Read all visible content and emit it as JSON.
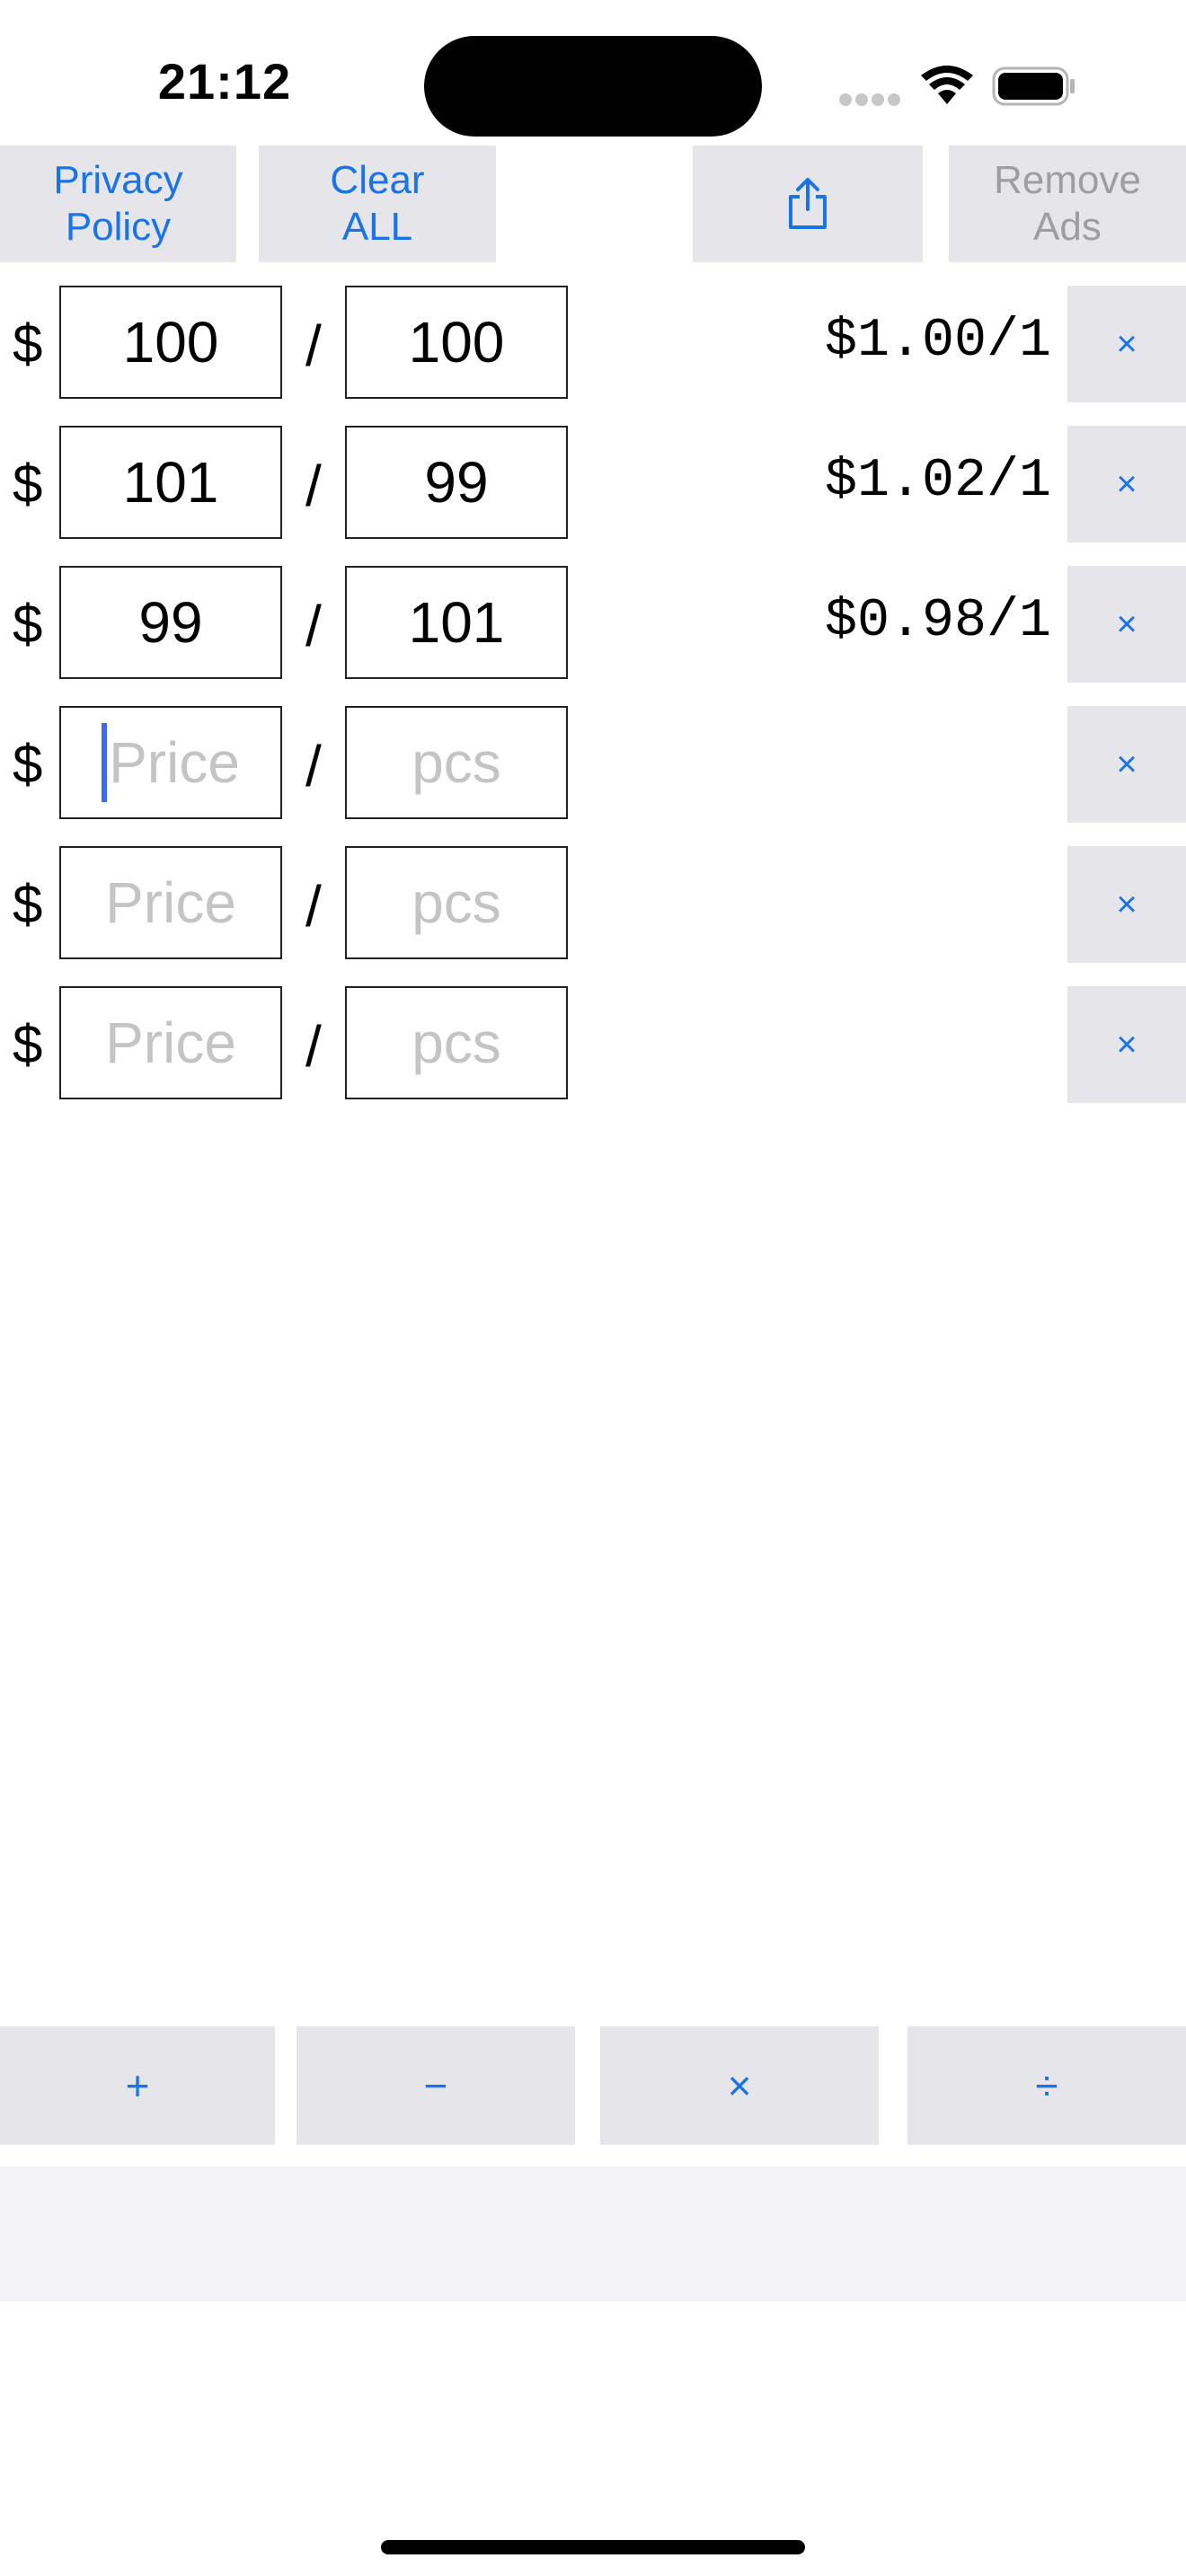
{
  "status_bar": {
    "time": "21:12"
  },
  "toolbar": {
    "privacy_label": "Privacy\nPolicy",
    "clear_label": "Clear\nALL",
    "remove_ads_label": "Remove\nAds",
    "share_icon": "share-icon"
  },
  "rows": [
    {
      "currency": "$",
      "separator": "/",
      "price": "100",
      "qty": "100",
      "unit_price": "$1.00/1",
      "delete_label": "×"
    },
    {
      "currency": "$",
      "separator": "/",
      "price": "101",
      "qty": "99",
      "unit_price": "$1.02/1",
      "delete_label": "×"
    },
    {
      "currency": "$",
      "separator": "/",
      "price": "99",
      "qty": "101",
      "unit_price": "$0.98/1",
      "delete_label": "×"
    },
    {
      "currency": "$",
      "separator": "/",
      "price_placeholder": "Price",
      "qty_placeholder": "pcs",
      "delete_label": "×"
    },
    {
      "currency": "$",
      "separator": "/",
      "price_placeholder": "Price",
      "qty_placeholder": "pcs",
      "delete_label": "×"
    },
    {
      "currency": "$",
      "separator": "/",
      "price_placeholder": "Price",
      "qty_placeholder": "pcs",
      "delete_label": "×"
    }
  ],
  "operators": {
    "plus": "+",
    "minus": "−",
    "times": "×",
    "divide": "÷"
  },
  "colors": {
    "accent": "#1a74e8",
    "button_bg": "#e5e5ea",
    "disabled_text": "#9e9e9e",
    "placeholder": "#c4c4c4",
    "banner_bg": "#f2f2f7"
  }
}
